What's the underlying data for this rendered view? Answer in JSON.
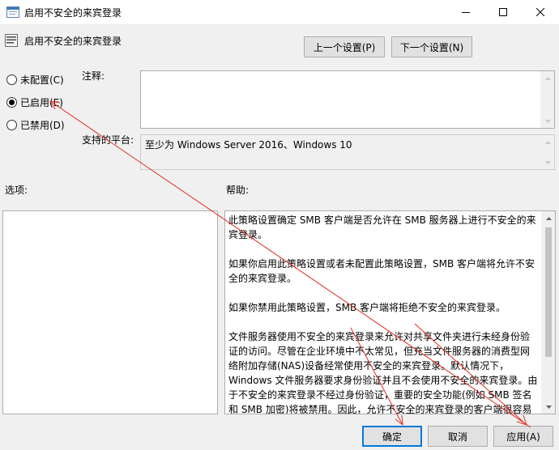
{
  "window": {
    "title": "启用不安全的来宾登录"
  },
  "header": {
    "title": "启用不安全的来宾登录",
    "prev_label": "上一个设置(P)",
    "next_label": "下一个设置(N)"
  },
  "options": {
    "not_configured": "未配置(C)",
    "enabled": "已启用(E)",
    "disabled": "已禁用(D)",
    "selected": "enabled"
  },
  "comment": {
    "label": "注释:",
    "value": ""
  },
  "platform": {
    "label": "支持的平台:",
    "value": "至少为 Windows Server 2016、Windows 10"
  },
  "sections": {
    "options_label": "选项:",
    "help_label": "帮助:"
  },
  "help": {
    "paragraphs": [
      "此策略设置确定 SMB 客户端是否允许在 SMB 服务器上进行不安全的来宾登录。",
      "如果你启用此策略设置或者未配置此策略设置，SMB 客户端将允许不安全的来宾登录。",
      "如果你禁用此策略设置，SMB 客户端将拒绝不安全的来宾登录。",
      "文件服务器使用不安全的来宾登录来允许对共享文件夹进行未经身份验证的访问。尽管在企业环境中不太常见，但充当文件服务器的消费型网络附加存储(NAS)设备经常使用不安全的来宾登录。默认情况下，Windows 文件服务器要求身份验证并且不会使用不安全的来宾登录。由于不安全的来宾登录不经过身份验证，重要的安全功能(例如 SMB 签名和 SMB 加密)将被禁用。因此，允许不安全的来宾登录的客户端很容易受到各种中间人攻击，从而导致数据丢失、数据损坏和遭受恶意软件的攻击。"
    ]
  },
  "footer": {
    "ok_label": "确定",
    "cancel_label": "取消",
    "apply_label": "应用(A)"
  },
  "colors": {
    "annotation": "#e0301e",
    "focus": "#0078d7"
  }
}
